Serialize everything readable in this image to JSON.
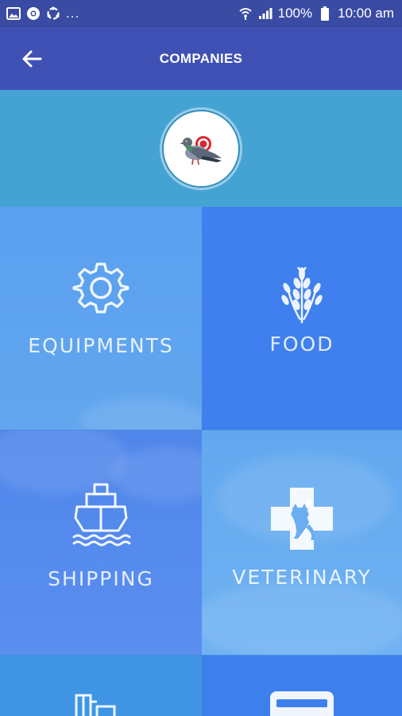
{
  "status_bar": {
    "dots": "...",
    "battery": "100%",
    "time": "10:00 am"
  },
  "app_bar": {
    "title": "COMPANIES"
  },
  "tiles": [
    {
      "label": "EQUIPMENTS",
      "icon": "gear-icon"
    },
    {
      "label": "FOOD",
      "icon": "wheat-icon"
    },
    {
      "label": "SHIPPING",
      "icon": "ship-icon"
    },
    {
      "label": "VETERINARY",
      "icon": "vet-cross-icon"
    },
    {
      "label": "",
      "icon": "building-icon"
    },
    {
      "label": "",
      "icon": "card-icon"
    }
  ],
  "colors": {
    "status_bar": "#3a4ba3",
    "app_bar": "#3f51b5",
    "banner": "#45a3d4"
  }
}
